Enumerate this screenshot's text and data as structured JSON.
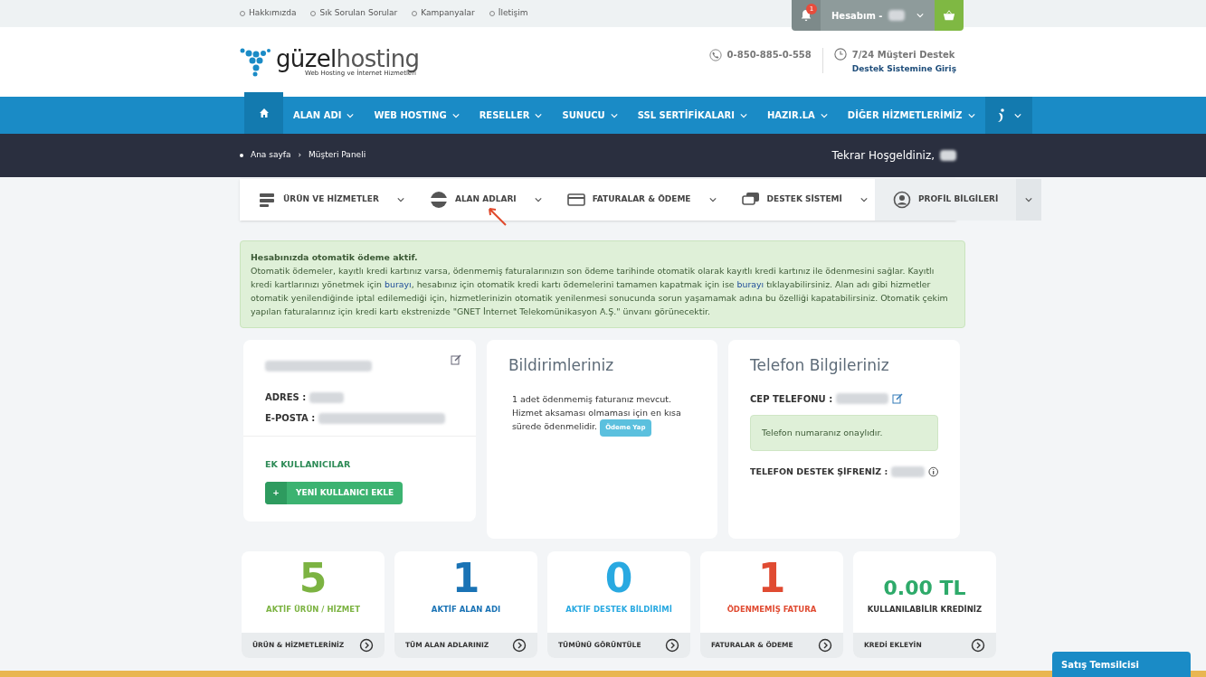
{
  "top_links": [
    "Hakkımızda",
    "Sık Sorulan Sorular",
    "Kampanyalar",
    "İletişim"
  ],
  "account": {
    "notification_count": "1",
    "label": "Hesabım -"
  },
  "logo": {
    "name_a": "güzel",
    "name_b": "hosting",
    "tagline": "Web Hosting ve İnternet Hizmetleri"
  },
  "contact": {
    "phone": "0-850-885-0-558",
    "support_title": "7/24 Müşteri Destek",
    "support_link": "Destek Sistemine Giriş"
  },
  "nav": [
    {
      "label": "ALAN ADI",
      "selected": false
    },
    {
      "label": "WEB HOSTING",
      "selected": false
    },
    {
      "label": "RESELLER",
      "selected": false
    },
    {
      "label": "SUNUCU",
      "selected": false
    },
    {
      "label": "SSL SERTİFİKALARI",
      "selected": false
    },
    {
      "label": "HAZIR.LA",
      "selected": false
    },
    {
      "label": "DİĞER HİZMETLERİMİZ",
      "selected": false
    }
  ],
  "breadcrumb": [
    "Ana sayfa",
    "›",
    "Müşteri Paneli"
  ],
  "welcome": "Tekrar Hoşgeldiniz,",
  "panel_menu": [
    {
      "label": "ÜRÜN VE HİZMETLER",
      "selected": false
    },
    {
      "label": "ALAN ADLARI",
      "selected": false
    },
    {
      "label": "FATURALAR & ÖDEME",
      "selected": false
    },
    {
      "label": "DESTEK SİSTEMİ",
      "selected": false
    },
    {
      "label": "PROFİL BİLGİLERİ",
      "selected": true
    }
  ],
  "alert": {
    "title": "Hesabınızda otomatik ödeme aktif.",
    "parts": [
      "Otomatik ödemeler, kayıtlı kredi kartınız varsa, ödenmemiş faturalarınızın son ödeme tarihinde otomatik olarak kayıtlı kredi kartınız ile ödenmesini sağlar. Kayıtlı kredi kartlarınızı yönetmek için ",
      "burayı",
      ", hesabınız için otomatik kredi kartı ödemelerini tamamen kapatmak için ise ",
      "burayı",
      " tıklayabilirsiniz. Alan adı gibi hizmetler otomatik yenilendiğinde iptal edilemediği için, hizmetlerinizin otomatik yenilenmesi sonucunda sorun yaşamamak adına bu özelliği kapatabilirsiniz. Otomatik çekim yapılan faturalarınız için kredi kartı ekstrenizde \"GNET İnternet Telekomünikasyon A.Ş.\" ünvanı görünecektir."
    ]
  },
  "profile": {
    "address_label": "ADRES :",
    "email_label": "E-POSTA :",
    "extra_users": "EK KULLANICILAR",
    "add_icon": "+",
    "add_button": "YENİ KULLANICI EKLE"
  },
  "notifications": {
    "title": "Bildirimleriniz",
    "text": "1 adet ödenmemiş faturanız mevcut. Hizmet aksaması olmaması için en kısa sürede ödenmelidir.",
    "button": "Ödeme Yap"
  },
  "phone": {
    "title": "Telefon Bilgileriniz",
    "mobile_label": "CEP TELEFONU :",
    "verified": "Telefon numaranız onaylıdır.",
    "pin_label": "TELEFON DESTEK ŞİFRENİZ :"
  },
  "stats": [
    {
      "value": "5",
      "label": "AKTİF ÜRÜN / HİZMET",
      "link": "ÜRÜN & HİZMETLERİNİZ",
      "color": "#7cb342"
    },
    {
      "value": "1",
      "label": "AKTİF ALAN ADI",
      "link": "TÜM ALAN ADLARINIZ",
      "color": "#1a73b5"
    },
    {
      "value": "0",
      "label": "AKTİF DESTEK BİLDİRİMİ",
      "link": "TÜMÜNÜ GÖRÜNTÜLE",
      "color": "#29a9e1"
    },
    {
      "value": "1",
      "label": "ÖDENMEMİŞ FATURA",
      "link": "FATURALAR & ÖDEME",
      "color": "#e04b32"
    },
    {
      "value": "0.00 TL",
      "label": "KULLANILABİLİR KREDİNİZ",
      "link": "KREDİ EKLEYİN",
      "color": "#2eaa6a"
    }
  ],
  "sales_button": "Satış Temsilcisi"
}
